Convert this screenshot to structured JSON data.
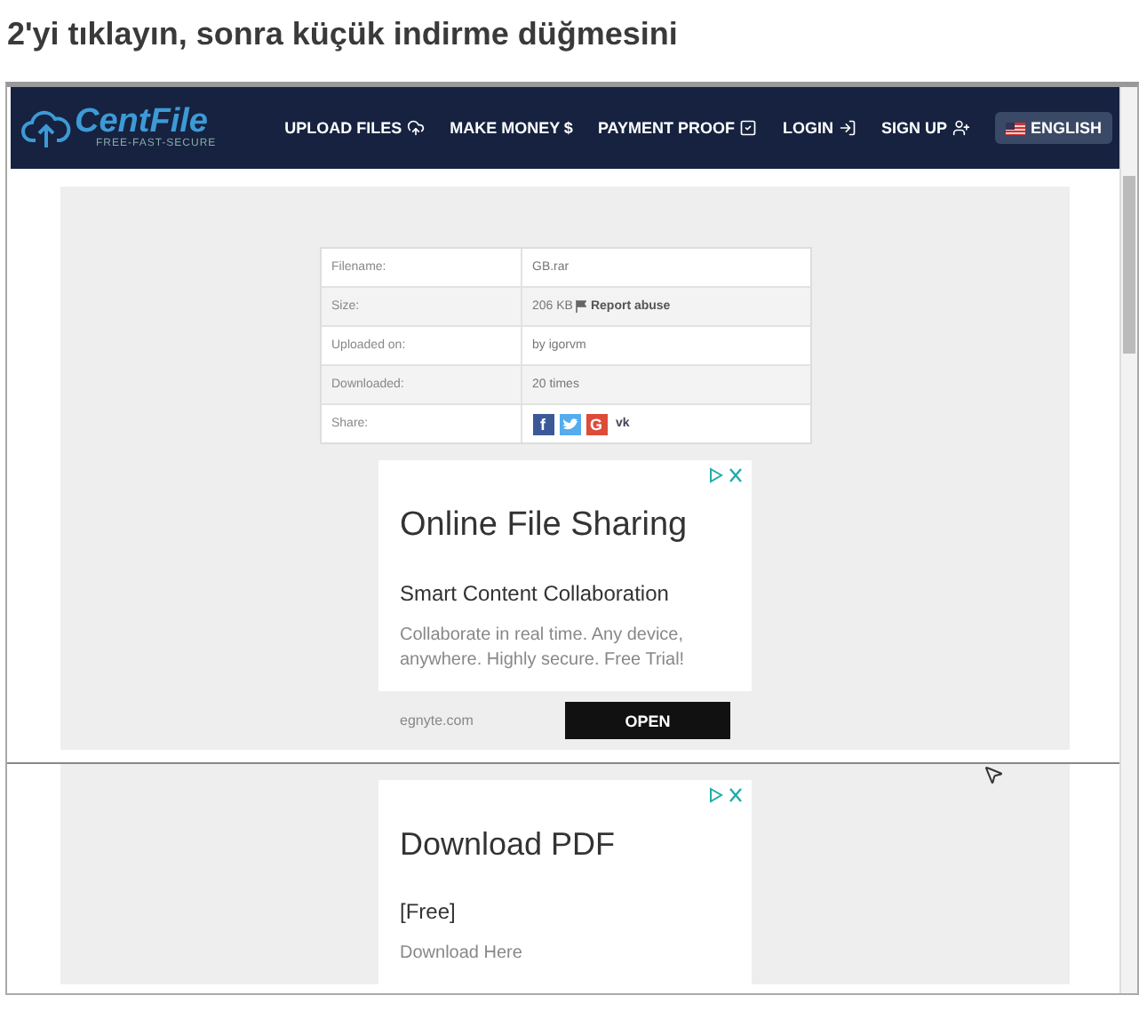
{
  "heading": "2'yi tıklayın, sonra küçük indirme düğmesini",
  "nav": {
    "logo": {
      "name": "CentFile",
      "tagline": "FREE-FAST-SECURE"
    },
    "items": [
      {
        "label": "UPLOAD FILES",
        "kind": "upload"
      },
      {
        "label": "MAKE MONEY $",
        "kind": "plain"
      },
      {
        "label": "PAYMENT PROOF",
        "kind": "check"
      },
      {
        "label": "LOGIN",
        "kind": "login"
      },
      {
        "label": "SIGN UP",
        "kind": "signup"
      }
    ],
    "language": "ENGLISH"
  },
  "file_info": [
    {
      "label": "Filename:",
      "value": "GB.rar"
    },
    {
      "label": "Size:",
      "value": "206 KB",
      "link": "Report abuse"
    },
    {
      "label": "Uploaded on:",
      "value": "by igorvm"
    },
    {
      "label": "Downloaded:",
      "value": "20 times"
    },
    {
      "label": "Share:",
      "share": [
        {
          "kind": "facebook",
          "glyph": "f"
        },
        {
          "kind": "twitter"
        },
        {
          "kind": "google",
          "glyph": "G"
        },
        {
          "kind": "vk",
          "glyph": "vk"
        }
      ]
    }
  ],
  "ads": [
    {
      "title": "Online File Sharing",
      "subtitle": "Smart Content Collaboration",
      "body": "Collaborate in real time. Any device, anywhere. Highly secure. Free Trial!",
      "domain": "egnyte.com",
      "button": "OPEN"
    },
    {
      "title": "Download PDF",
      "subtitle": "[Free]",
      "body": "Download Here"
    }
  ]
}
